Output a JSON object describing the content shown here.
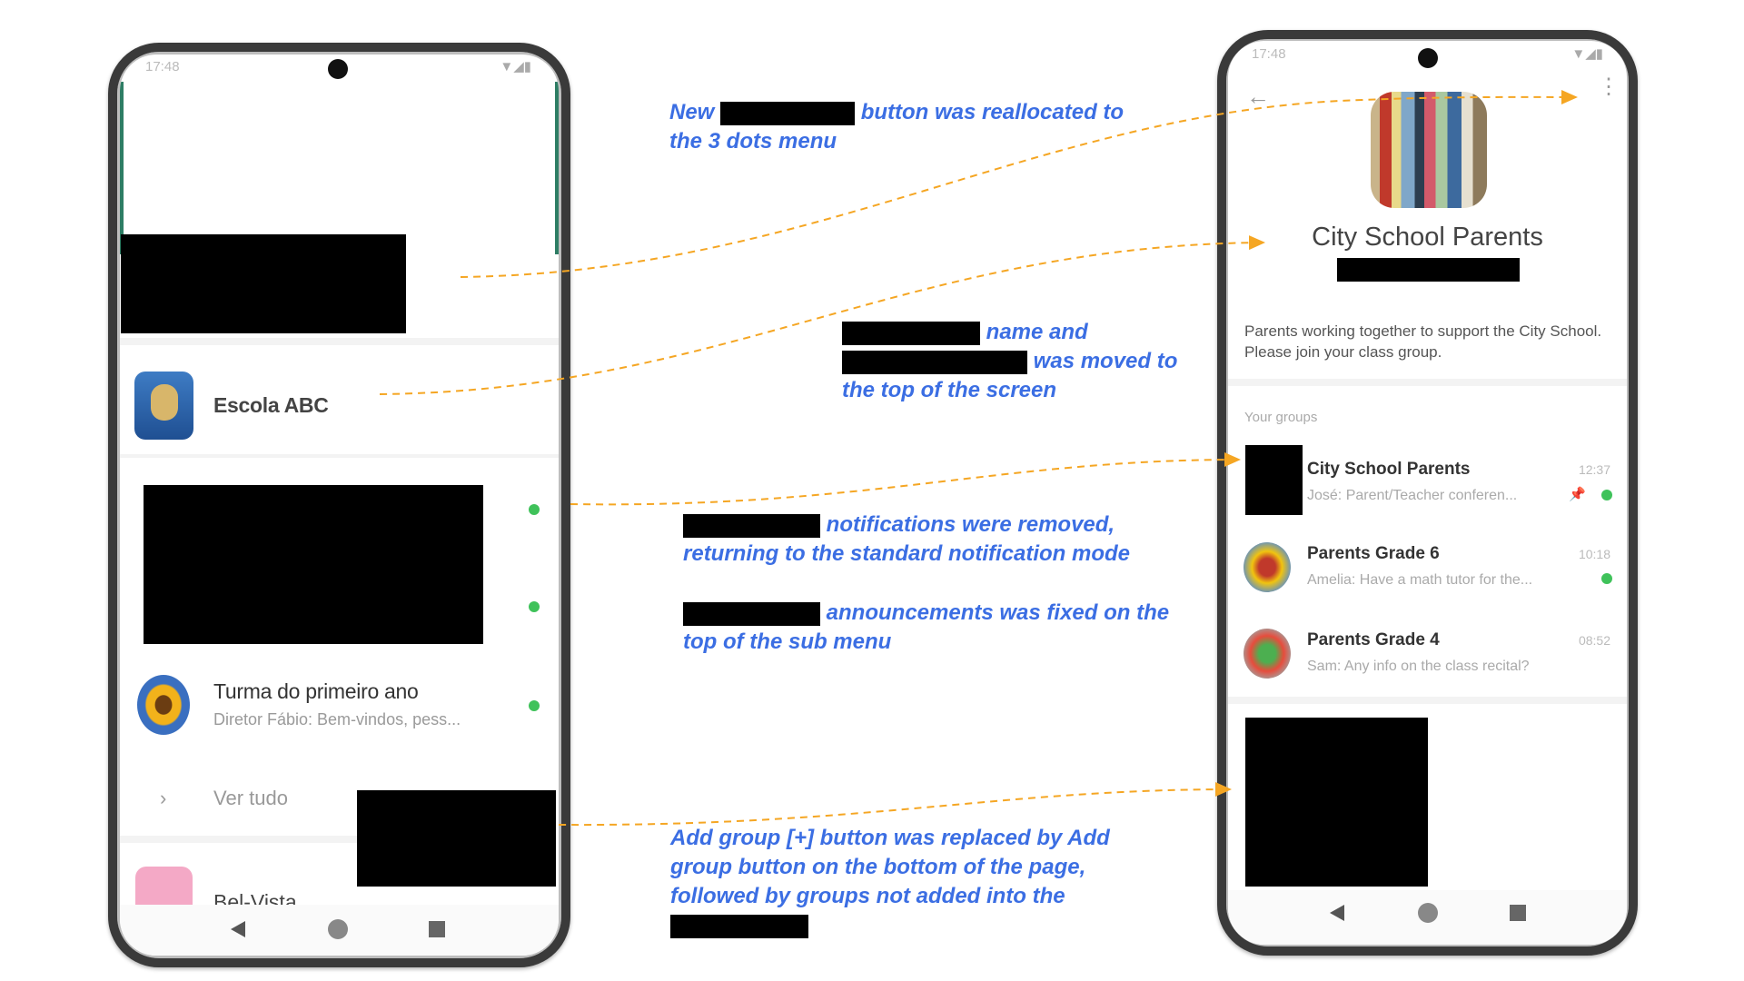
{
  "left_phone": {
    "status_time": "17:48",
    "community_name": "Escola ABC",
    "group": {
      "title": "Turma do primeiro ano",
      "preview": "Diretor Fábio: Bem-vindos, pess..."
    },
    "view_all": "Ver tudo",
    "next_item_partial": "Bel-Vista"
  },
  "right_phone": {
    "status_time": "17:48",
    "community_name": "City School Parents",
    "description": "Parents working together to support the City School. Please join your class group.",
    "section_label": "Your groups",
    "groups": [
      {
        "title": "City School Parents",
        "preview": "José: Parent/Teacher conferen...",
        "time": "12:37",
        "pinned": true,
        "unread": true
      },
      {
        "title": "Parents Grade 6",
        "preview": "Amelia: Have a math tutor for the...",
        "time": "10:18",
        "unread": true
      },
      {
        "title": "Parents Grade 4",
        "preview": "Sam: Any info on the class recital?",
        "time": "08:52",
        "unread": false
      }
    ]
  },
  "annotations": {
    "a1": {
      "before": "New",
      "after": "button was reallocated to",
      "line2": "the 3 dots menu"
    },
    "a2": {
      "line1": "name and",
      "line2": "was moved to",
      "line3": "the top of the screen"
    },
    "a3": {
      "line1": "notifications were removed,",
      "line2": "returning to the standard notification mode"
    },
    "a4": {
      "line1": "announcements was fixed on the",
      "line2": "top of the sub menu"
    },
    "a5": {
      "line1": "Add group [+]  button was replaced by Add",
      "line2": "group button on the bottom of the page,",
      "line3": "followed by groups not added into the"
    }
  },
  "colors": {
    "annotation": "#3b6ee3",
    "arrow": "#f5a623",
    "unread": "#3fc25a",
    "accent": "#2e7d64"
  }
}
